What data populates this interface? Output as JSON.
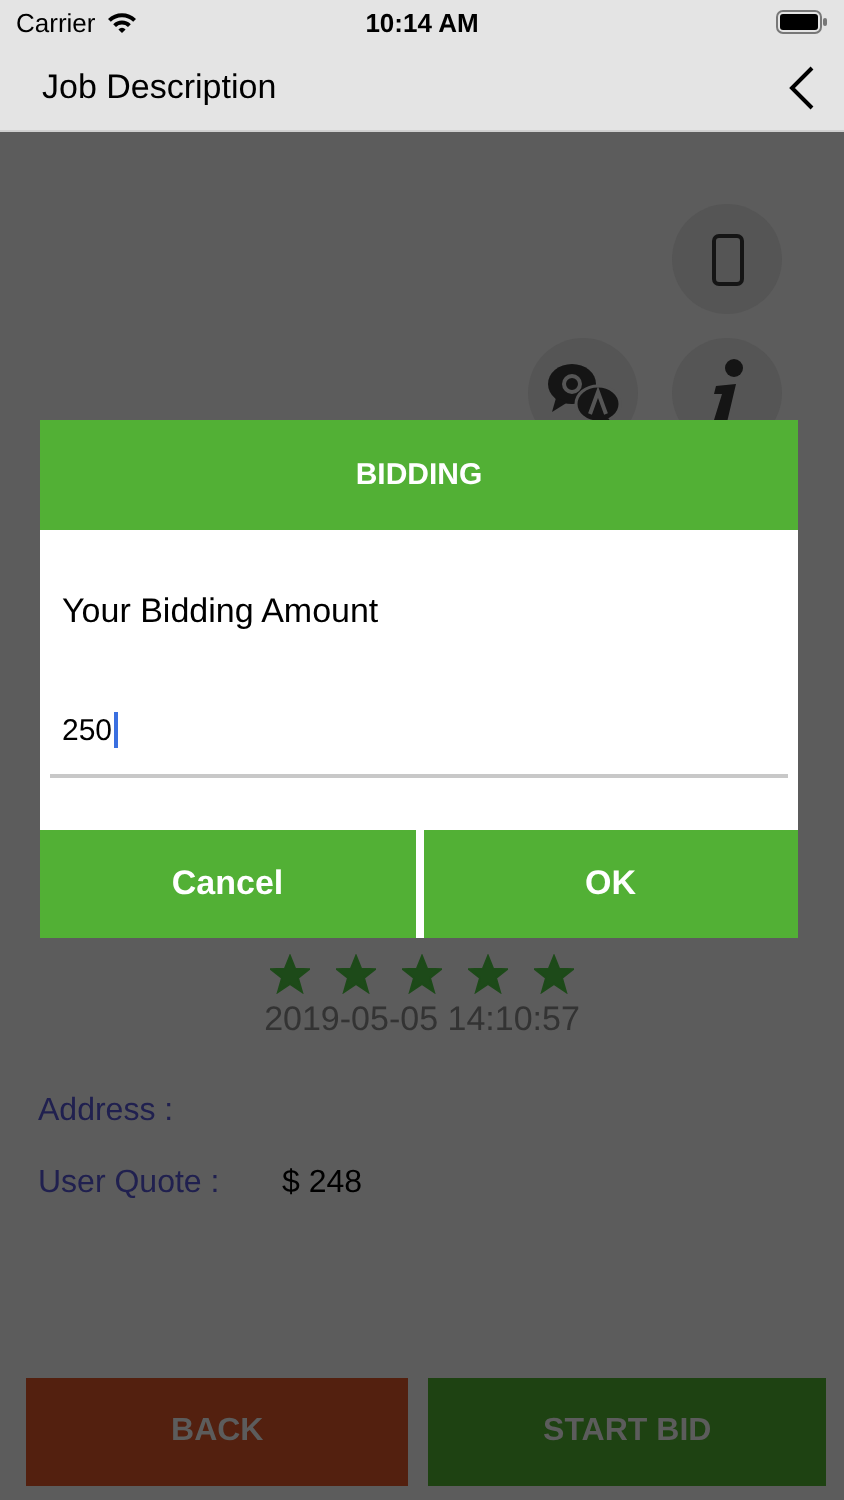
{
  "status_bar": {
    "carrier": "Carrier",
    "time": "10:14 AM"
  },
  "nav_bar": {
    "title": "Job Description"
  },
  "job": {
    "stars": 5,
    "date": "2019-05-05 14:10:57",
    "fields": [
      {
        "label": "Address :"
      },
      {
        "label": "User Quote :",
        "value": "$ 248"
      }
    ]
  },
  "actions": [
    {
      "label": "BACK",
      "kind": "back"
    },
    {
      "label": "START BID",
      "kind": "start"
    }
  ],
  "dialog": {
    "title": "BIDDING",
    "prompt": "Your Bidding Amount",
    "input_value": "250",
    "buttons": [
      "Cancel",
      "OK"
    ]
  }
}
